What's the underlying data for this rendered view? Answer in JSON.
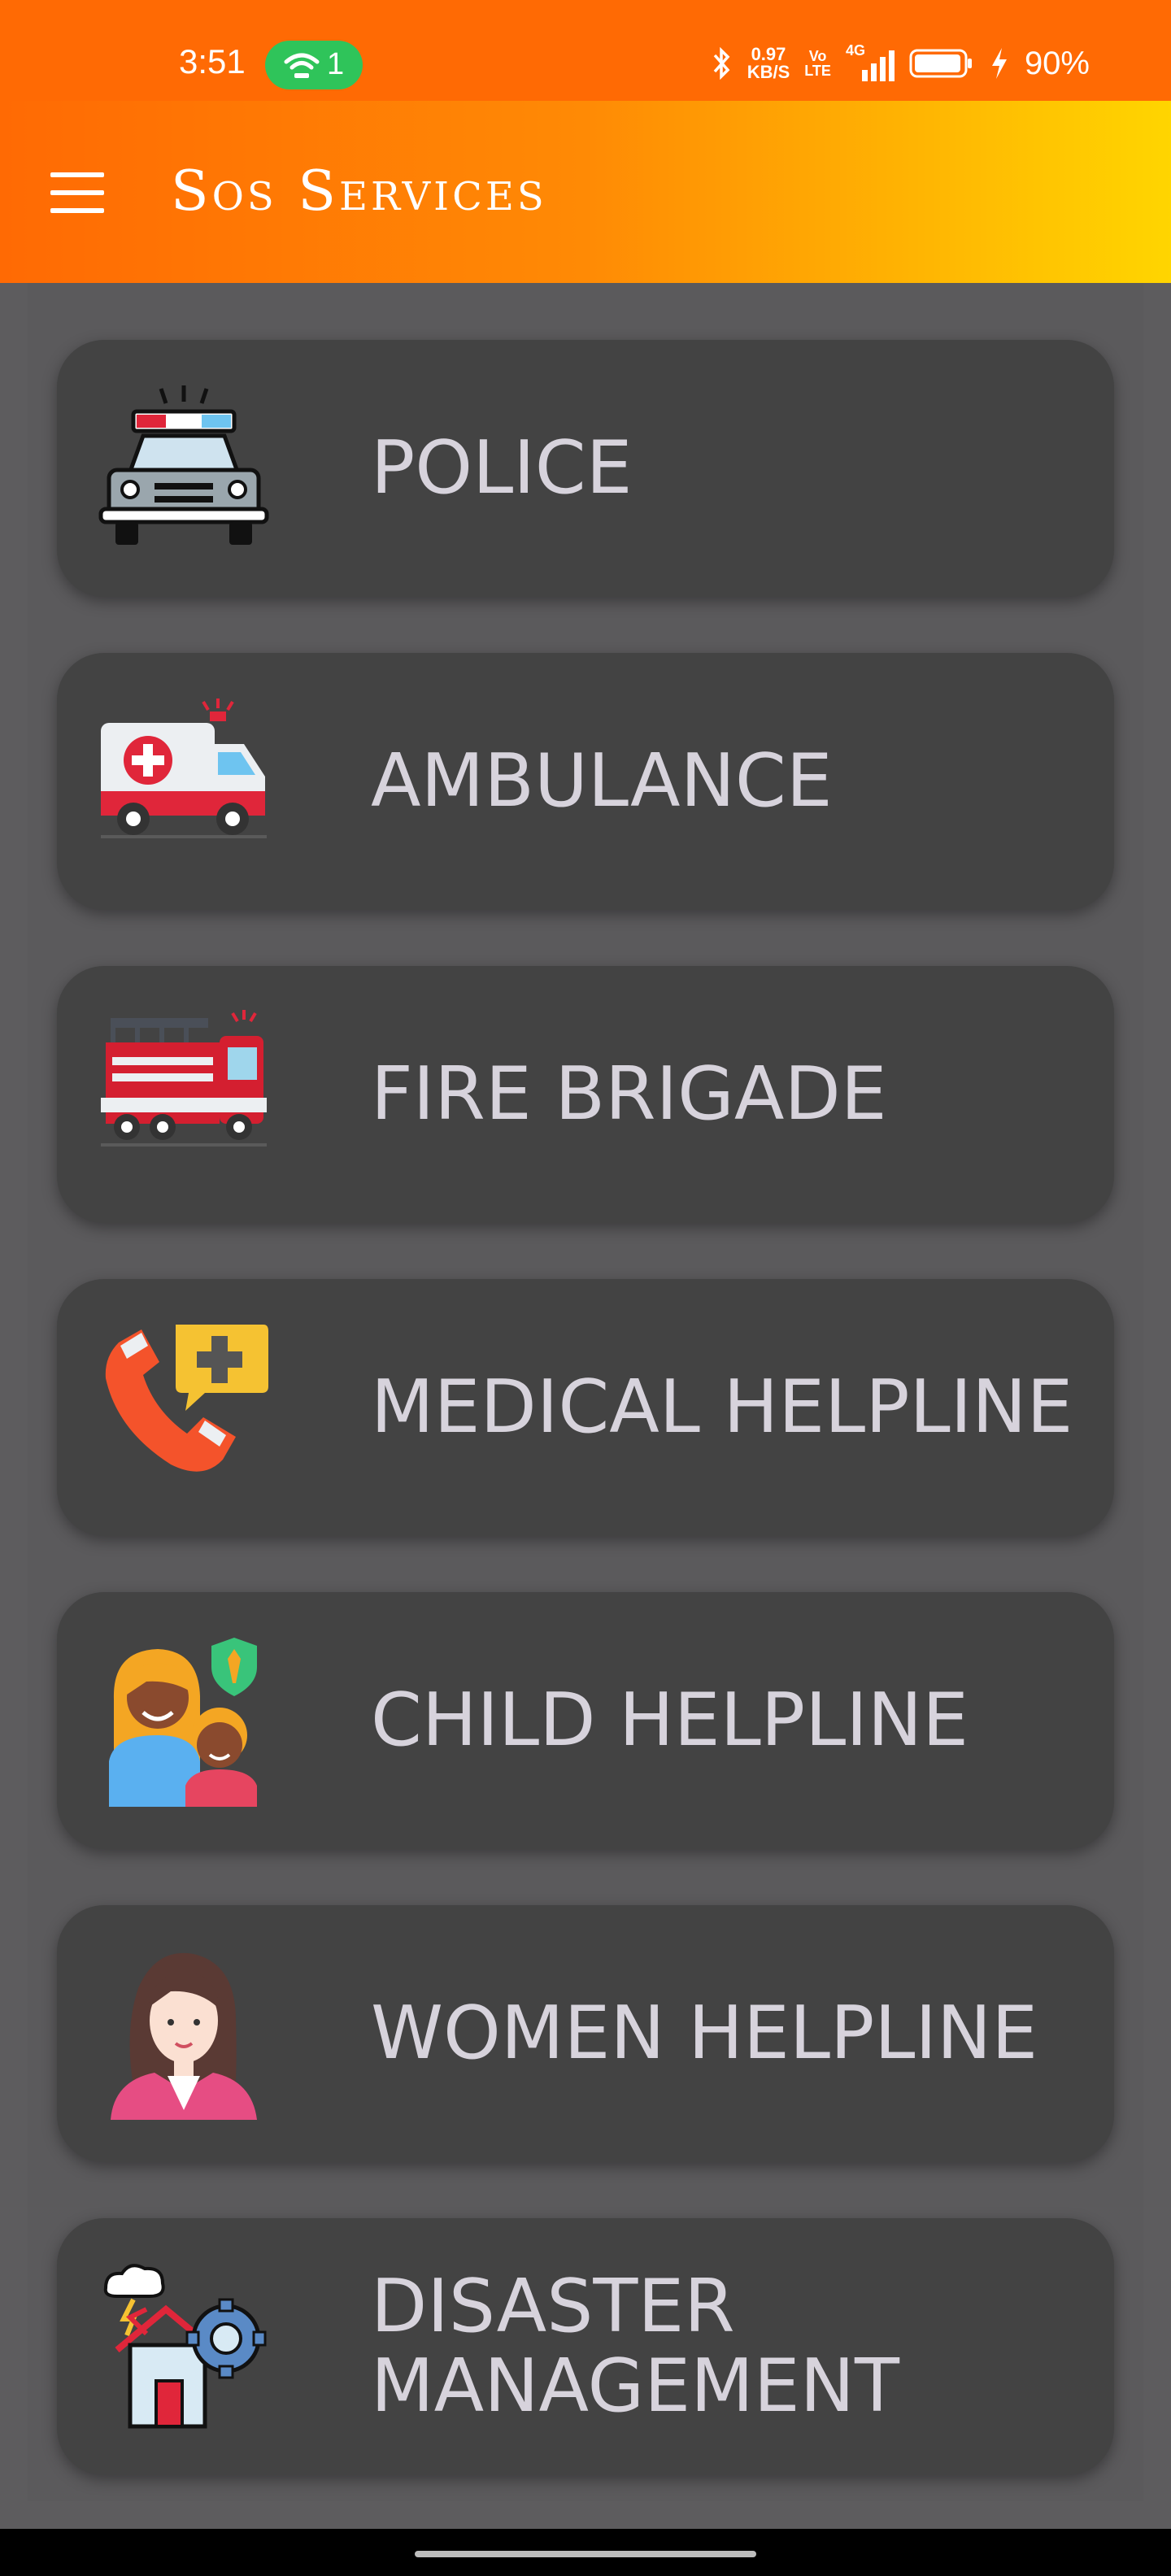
{
  "status_bar": {
    "time": "3:51",
    "hotspot_count": "1",
    "speed_value": "0.97",
    "speed_unit": "KB/S",
    "volte_top": "Vo",
    "volte_bottom": "LTE",
    "network": "4G",
    "battery_percent": "90%",
    "icons": [
      "wifi-hotspot-icon",
      "bluetooth-icon",
      "signal-icon",
      "battery-icon",
      "charging-icon"
    ]
  },
  "app_bar": {
    "title": "Sos Services",
    "menu_icon": "hamburger-menu-icon",
    "colors": {
      "start": "#ff6a04",
      "end": "#ffd500"
    }
  },
  "services": [
    {
      "label": "POLICE",
      "icon": "police-car-icon"
    },
    {
      "label": "AMBULANCE",
      "icon": "ambulance-icon"
    },
    {
      "label": "FIRE BRIGADE",
      "icon": "fire-truck-icon"
    },
    {
      "label": "MEDICAL HELPLINE",
      "icon": "medical-phone-icon"
    },
    {
      "label": "CHILD HELPLINE",
      "icon": "child-helpline-icon"
    },
    {
      "label": "WOMEN HELPLINE",
      "icon": "woman-icon"
    },
    {
      "label": "DISASTER MANAGEMENT",
      "icon": "disaster-icon"
    }
  ],
  "colors": {
    "card": "#434343",
    "background": "#5b5a5c",
    "label": "#d7d3dc"
  }
}
